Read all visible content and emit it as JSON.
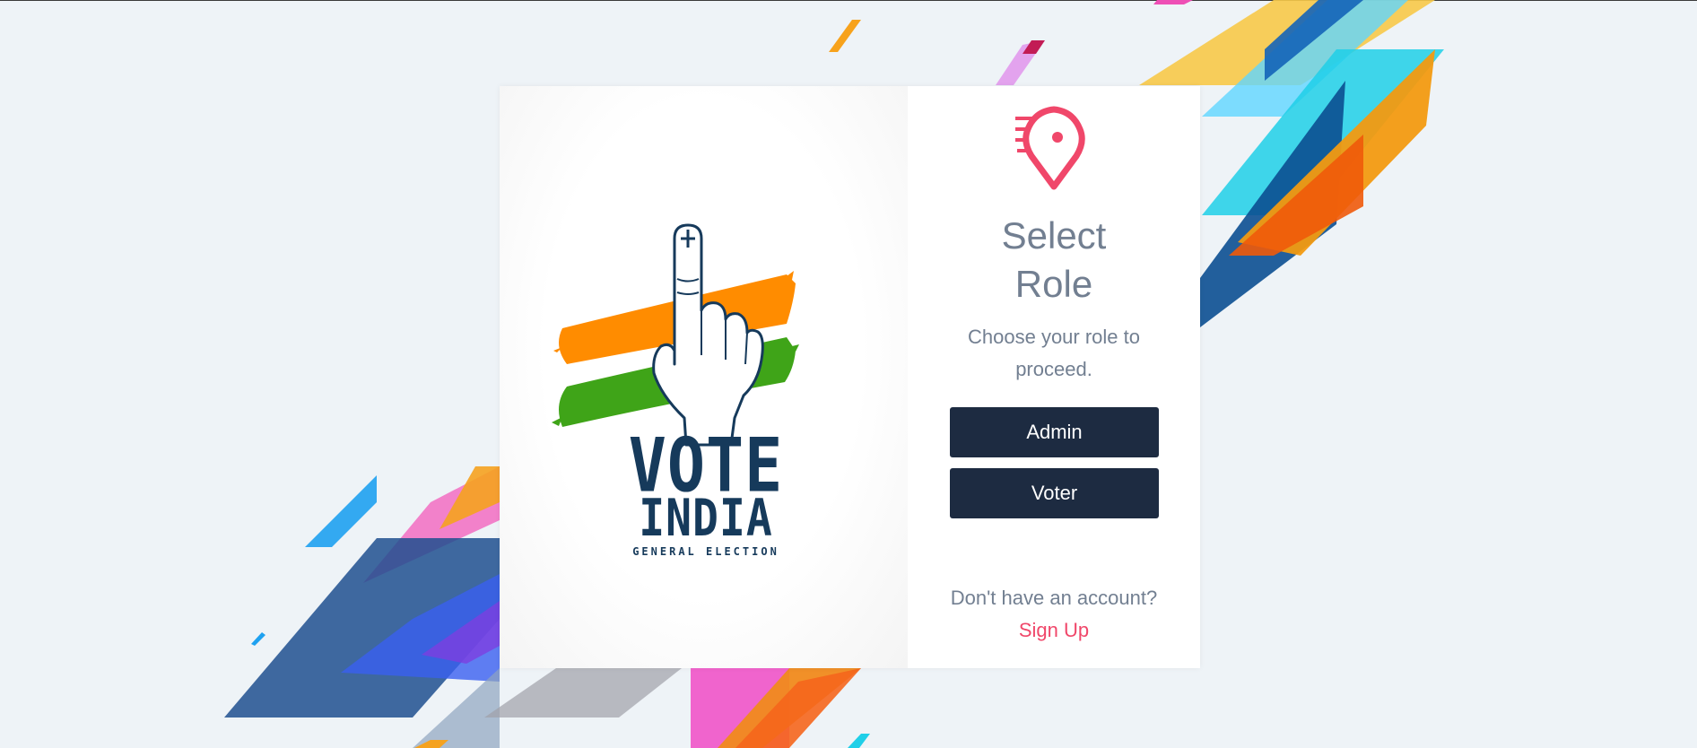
{
  "auth": {
    "title_line1": "Select",
    "title_line2": "Role",
    "subtitle": "Choose your role to proceed.",
    "admin_label": "Admin",
    "voter_label": "Voter",
    "no_account_text": "Don't have an account?",
    "signup_label": "Sign Up"
  },
  "poster": {
    "line1": "VOTE",
    "line2": "INDIA",
    "line3": "GENERAL ELECTION"
  },
  "icons": {
    "logo": "location-pin-icon",
    "hand": "inked-finger-icon"
  },
  "colors": {
    "page_background": "#eef3f7",
    "button_background": "#1d2b41",
    "accent": "#f0476a",
    "muted_text": "#727f91",
    "saffron": "#ff8c00",
    "green": "#3fa418",
    "navy": "#163a5b"
  }
}
